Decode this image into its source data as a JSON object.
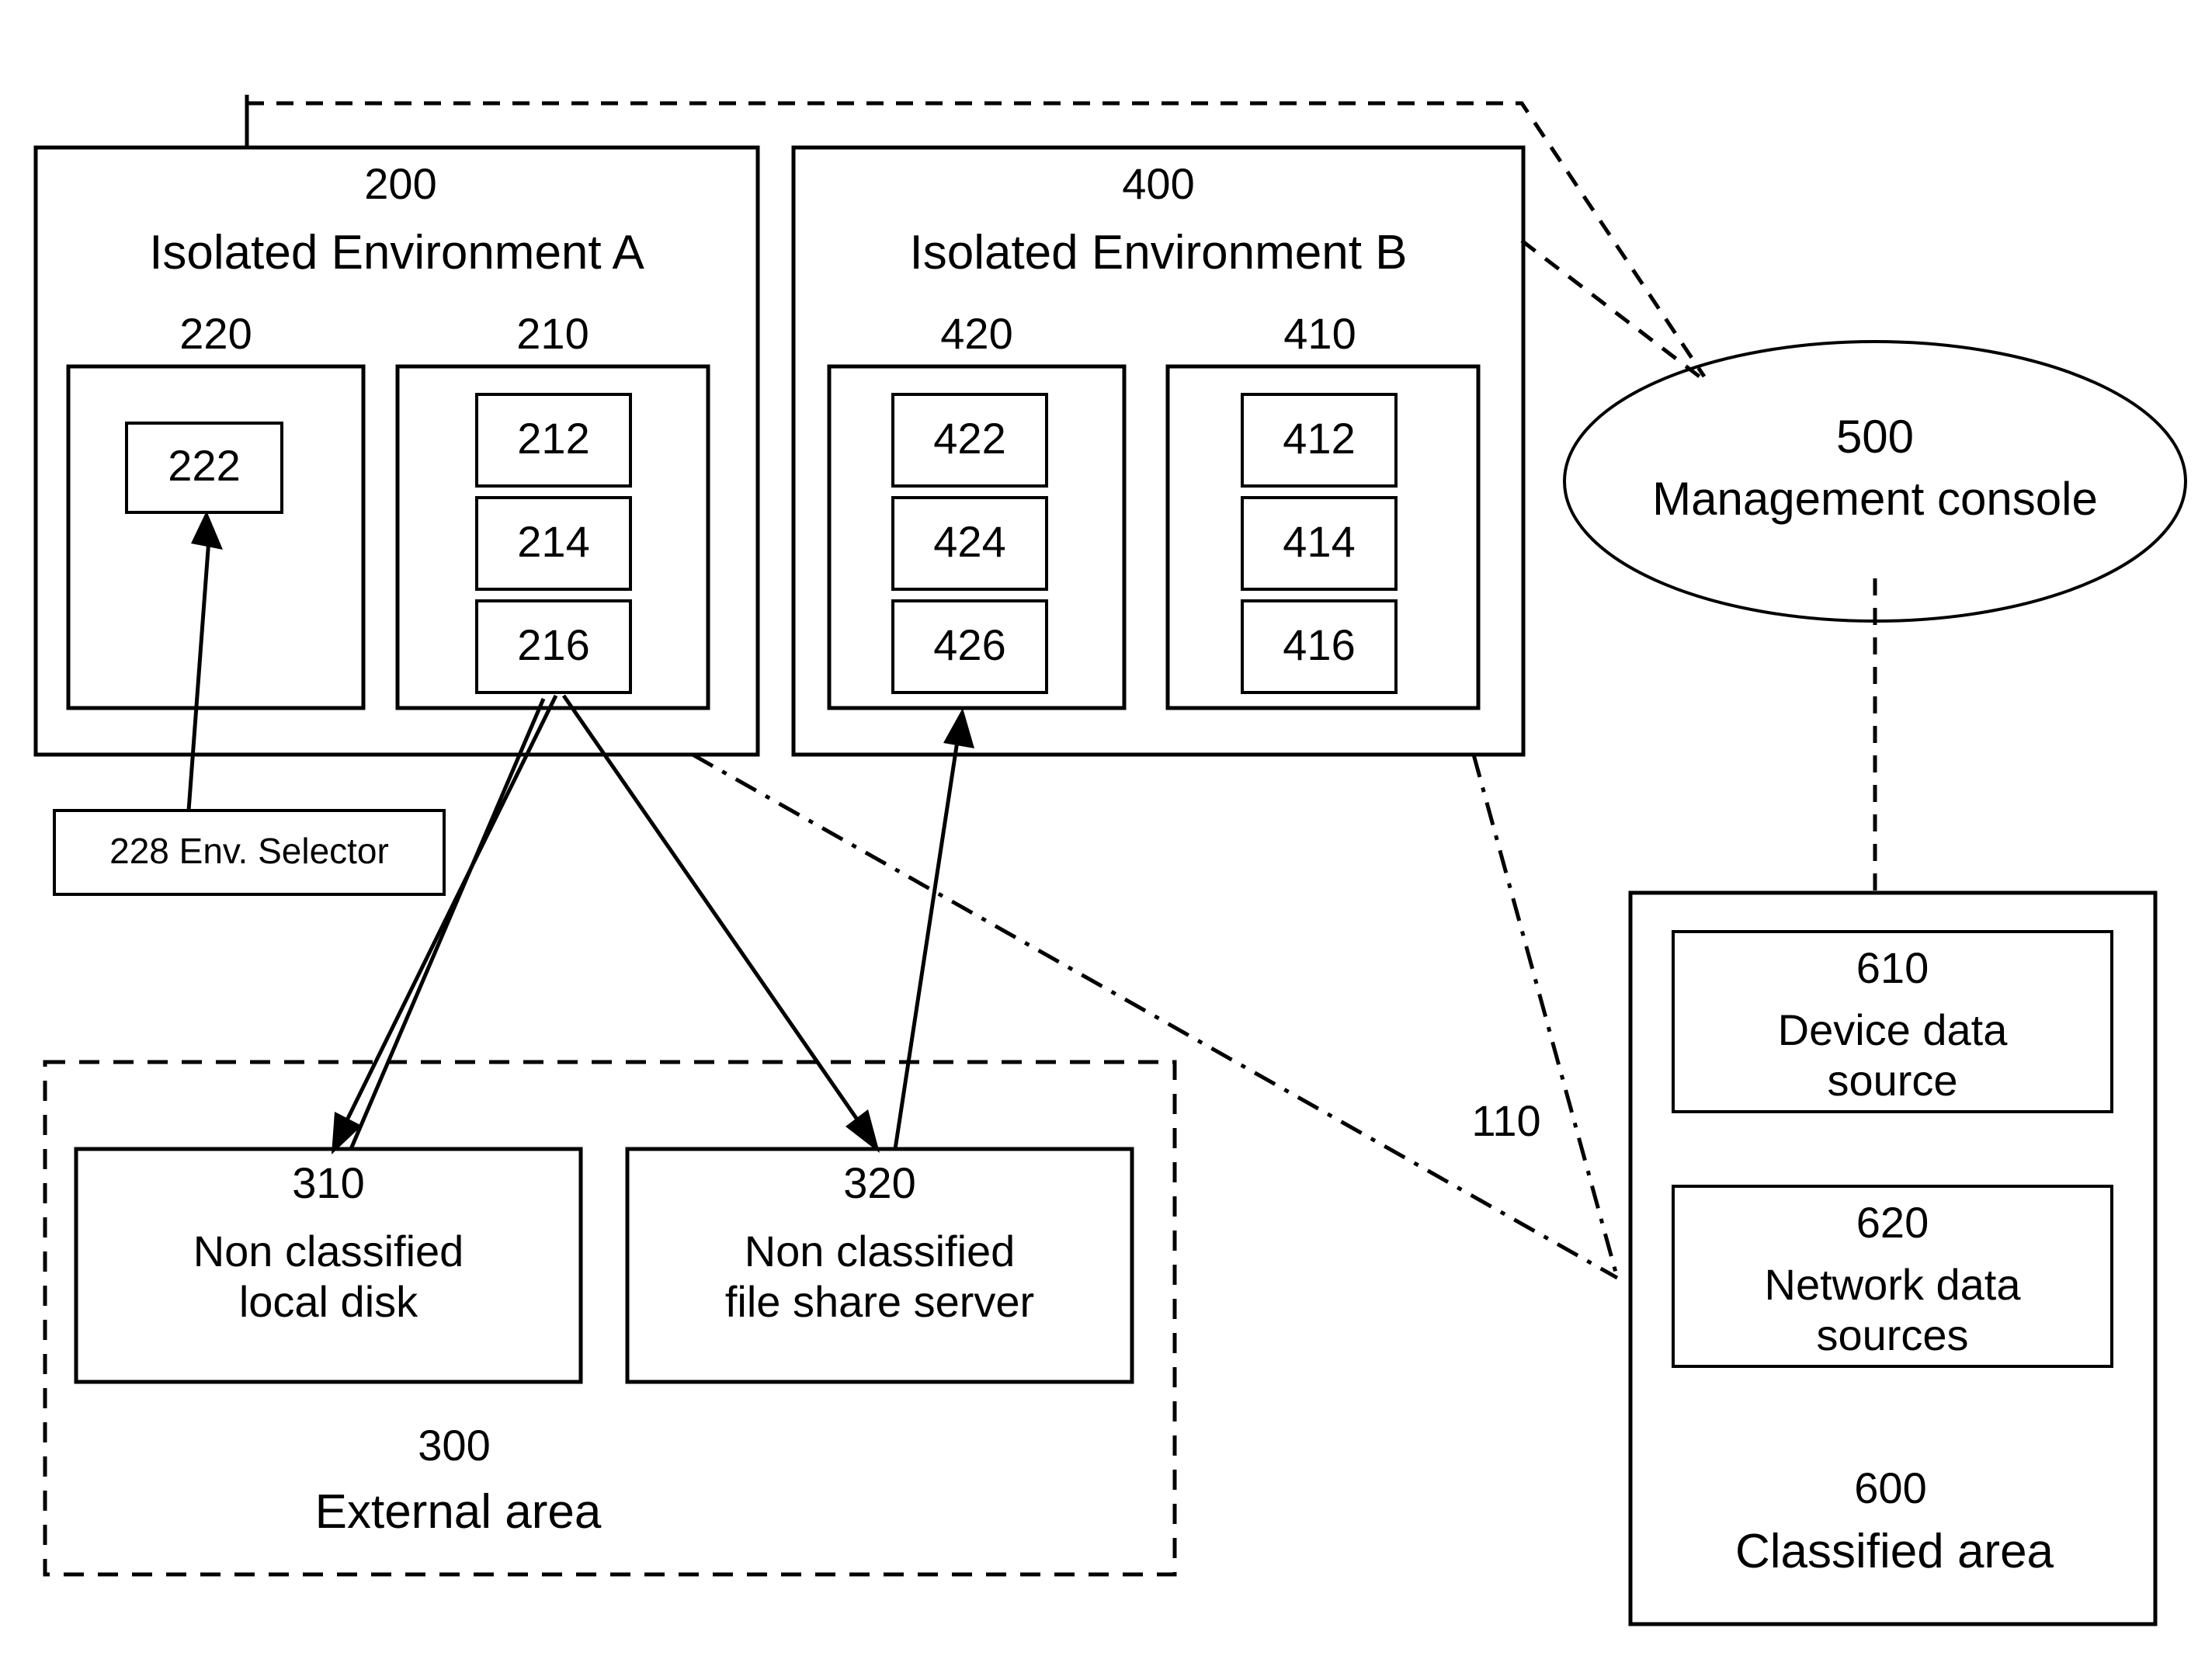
{
  "figure": {
    "type": "patent-block-diagram",
    "background": "#ffffff",
    "line_color": "#000000"
  },
  "environments": {
    "a": {
      "ref": "200",
      "title": "Isolated Environment A",
      "groups": [
        {
          "ref": "220",
          "children": [
            {
              "ref": "222"
            }
          ]
        },
        {
          "ref": "210",
          "children": [
            {
              "ref": "212"
            },
            {
              "ref": "214"
            },
            {
              "ref": "216"
            }
          ]
        }
      ]
    },
    "b": {
      "ref": "400",
      "title": "Isolated Environment B",
      "groups": [
        {
          "ref": "420",
          "children": [
            {
              "ref": "422"
            },
            {
              "ref": "424"
            },
            {
              "ref": "426"
            }
          ]
        },
        {
          "ref": "410",
          "children": [
            {
              "ref": "412"
            },
            {
              "ref": "414"
            },
            {
              "ref": "416"
            }
          ]
        }
      ]
    }
  },
  "env_selector": {
    "label": "228 Env. Selector"
  },
  "management_console": {
    "ref": "500",
    "title": "Management console"
  },
  "external_area": {
    "ref": "300",
    "title": "External area",
    "items": [
      {
        "ref": "310",
        "title": "Non classified\nlocal disk"
      },
      {
        "ref": "320",
        "title": "Non classified\nfile share server"
      }
    ]
  },
  "classified_area": {
    "ref": "600",
    "title": "Classified area",
    "items": [
      {
        "ref": "610",
        "title": "Device  data\nsource"
      },
      {
        "ref": "620",
        "title": "Network data\nsources"
      }
    ]
  },
  "network_link": {
    "ref": "110"
  }
}
